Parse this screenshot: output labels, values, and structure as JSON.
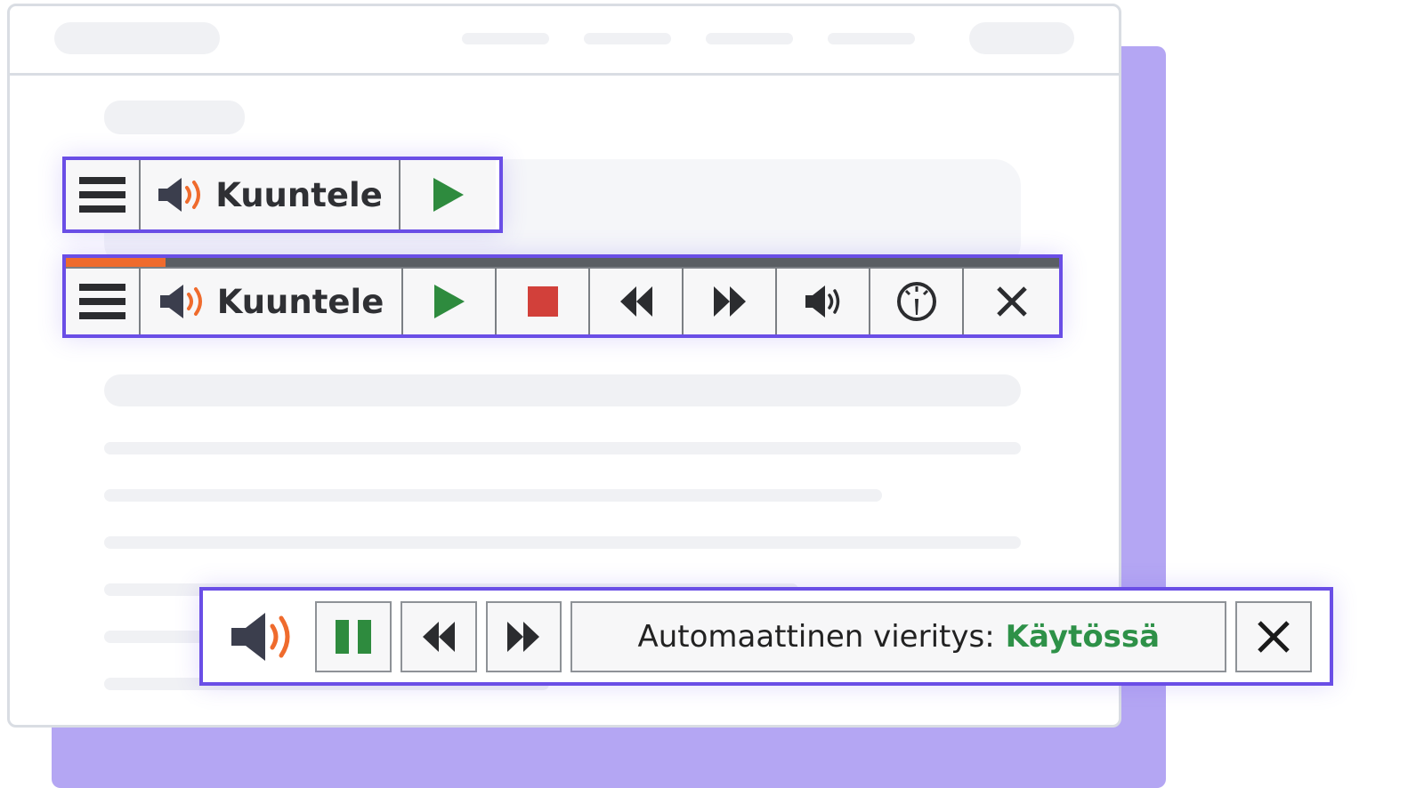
{
  "colors": {
    "accent": "#6a4ee6",
    "shadow_card": "#b4a6f3",
    "play_green": "#2e8b3e",
    "stop_red": "#d2403a",
    "speaker_waves": "#ef6b2d",
    "status_enabled": "#2e9148"
  },
  "compact_player": {
    "label": "Kuuntele",
    "icons": [
      "menu-icon",
      "speaker-icon",
      "play-icon"
    ]
  },
  "expanded_player": {
    "label": "Kuuntele",
    "progress_fraction": 0.1,
    "icons": [
      "menu-icon",
      "speaker-icon",
      "play-icon",
      "stop-icon",
      "rewind-icon",
      "fast-forward-icon",
      "volume-icon",
      "speed-gauge-icon",
      "close-icon"
    ]
  },
  "autoscroll_bar": {
    "status_label": "Automaattinen vieritys:",
    "status_value": "Käytössä",
    "icons": [
      "speaker-icon",
      "pause-icon",
      "rewind-icon",
      "fast-forward-icon",
      "close-icon"
    ]
  }
}
